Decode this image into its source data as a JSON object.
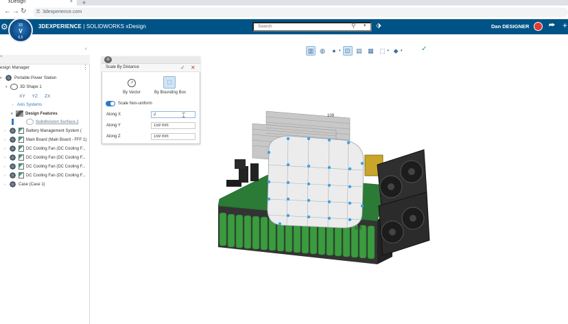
{
  "browser": {
    "tab_title": "xDesign",
    "url": "3dexperience.com",
    "tab_close": "×",
    "new_tab": "+"
  },
  "app": {
    "brand_bold": "3DEXPERIENCE",
    "brand_rest": " | SOLIDWORKS xDesign",
    "search_placeholder": "Search",
    "user_name": "Dan DESIGNER",
    "compass_top": "3D",
    "compass_mid": "V",
    "compass_bottom": "6.5",
    "colors": {
      "header": "#005386",
      "accent": "#2b79c2",
      "ok": "#2e9d3d",
      "cancel": "#d32f2f"
    }
  },
  "panel": {
    "title": "esign Manager",
    "tree": [
      {
        "label": "Portable Power Station",
        "icon": "assembly-icon"
      },
      {
        "label": "3D Shape 1",
        "icon": "shape-icon"
      },
      {
        "label": "Axis Systems",
        "icon": ""
      },
      {
        "label": "Design Features",
        "icon": "feature-icon"
      },
      {
        "label": "Subdivision Surface.1",
        "icon": "subdivision-icon"
      },
      {
        "label": "Battery Management System (",
        "icon": "part-icon"
      },
      {
        "label": "Main Board (Main Board - FFF 1)",
        "icon": "part-icon"
      },
      {
        "label": "DC Cooling Fan (DC Cooling F...",
        "icon": "part-icon"
      },
      {
        "label": "DC Cooling Fan (DC Cooling F...",
        "icon": "part-icon"
      },
      {
        "label": "DC Cooling Fan (DC Cooling F...",
        "icon": "part-icon"
      },
      {
        "label": "DC Cooling Fan (DC Cooling F...",
        "icon": "part-icon"
      },
      {
        "label": "Case (Case 1)",
        "icon": "part-icon"
      }
    ],
    "sub_icons": [
      "XY",
      "YZ",
      "ZX"
    ]
  },
  "dialog": {
    "title": "Scale By Distance",
    "options": [
      {
        "label": "By Vector",
        "active": false
      },
      {
        "label": "By Bounding Box",
        "active": true
      }
    ],
    "toggle_label": "Scale Non-uniform",
    "toggle_on": true,
    "fields": [
      {
        "label": "Along X",
        "value": "2"
      },
      {
        "label": "Along Y",
        "value": "159 mm"
      },
      {
        "label": "Along Z",
        "value": "159 mm"
      }
    ]
  },
  "viewport": {
    "dimensions": [
      "109",
      "109"
    ]
  }
}
